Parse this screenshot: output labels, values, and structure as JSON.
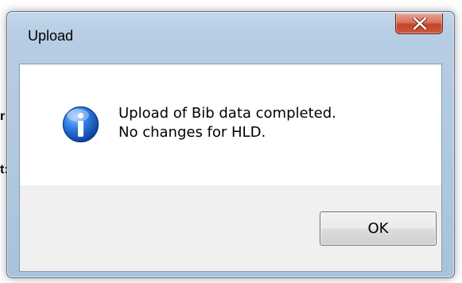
{
  "background": {
    "fragment_1": "r",
    "fragment_2": "t:"
  },
  "dialog": {
    "title": "Upload",
    "close_icon": "close-x-icon",
    "message_icon": "information-icon",
    "message_lines": [
      "Upload of Bib data completed.",
      "No changes for HLD."
    ],
    "ok_label": "OK"
  },
  "colors": {
    "title_bar": "#b7cde3",
    "close_button": "#c34428",
    "info_icon": "#1e63c6",
    "client_background": "#f0f0f0",
    "message_background": "#ffffff"
  }
}
